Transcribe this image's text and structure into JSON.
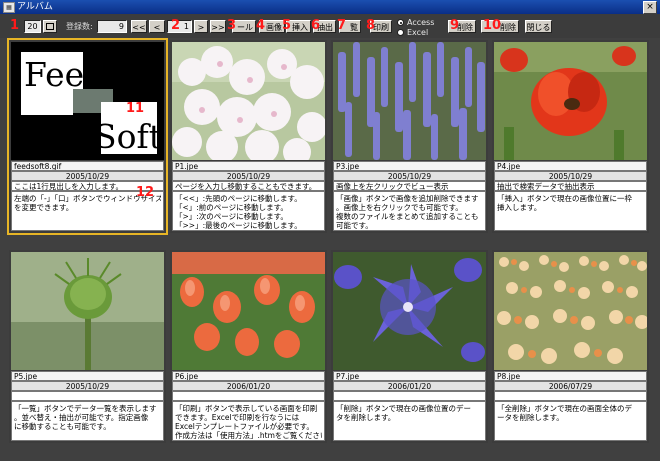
{
  "window": {
    "title": "アルバム",
    "close": "×"
  },
  "toolbar": {
    "count_value": "20",
    "label_registered": "登録数:",
    "registered_value": "9",
    "first": "<<",
    "prev": "<",
    "page_value": "1",
    "next": ">",
    "last": ">>",
    "tool": "ール",
    "image": "画像",
    "insert": "挿入",
    "extract": "抽出",
    "list": "覧",
    "print": "印刷",
    "radio_access": "Access",
    "radio_excel": "Excel",
    "delete": "削除",
    "delete_all": "削除",
    "close": "閉じる"
  },
  "markers": [
    "1",
    "2",
    "3",
    "4",
    "5",
    "6",
    "7",
    "8",
    "9",
    "10",
    "11",
    "12"
  ],
  "cards": [
    {
      "file": "feedsoft8.gif",
      "date": "2005/10/29",
      "caption": "ここは1行見出しを入力します。",
      "desc": [
        "左端の「-」「口」ボタンでウィンドウサイズ",
        "を変更できます。",
        ""
      ],
      "logo_text_top": "Feed",
      "logo_text_bottom": "Soft"
    },
    {
      "file": "P1.jpe",
      "date": "2005/10/29",
      "caption": "ページを入力し移動することもできます。",
      "desc": [
        "「<<」:先頭のページに移動します。",
        "「<」:前のページに移動します。",
        "「>」:次のページに移動します。",
        "「>>」:最後のページに移動します。"
      ]
    },
    {
      "file": "P3.jpe",
      "date": "2005/10/29",
      "caption": "画像上を左クリックでビュー表示",
      "desc": [
        "「画像」ボタンで画像を追加削除できます",
        "。画像上を右クリックでも可能です。",
        "複数のファイルをまとめて追加することも",
        "可能です。"
      ]
    },
    {
      "file": "P4.jpe",
      "date": "2005/10/29",
      "caption": "抽出で検索データで抽出表示",
      "desc": [
        "「挿入」ボタンで現在の画像位置に一枠",
        "挿入します。",
        ""
      ]
    },
    {
      "file": "P5.jpe",
      "date": "2005/10/29",
      "caption": "",
      "desc": [
        "「一覧」ボタンでデータ一覧を表示します",
        "。並べ替え・抽出が可能です。指定画像",
        "に移動することも可能です。"
      ]
    },
    {
      "file": "P6.jpe",
      "date": "2006/01/20",
      "caption": "",
      "desc": [
        "「印刷」ボタンで表示している画面を印刷",
        "できます。Excelで印刷を行なうには",
        "Excelテンプレートファイルが必要です。",
        "作成方法は「使用方法」.htmをご覧ください"
      ]
    },
    {
      "file": "P7.jpe",
      "date": "2006/01/20",
      "caption": "",
      "desc": [
        "「削除」ボタンで現在の画像位置のデー",
        "タを削除します。",
        ""
      ]
    },
    {
      "file": "P8.jpe",
      "date": "2006/07/29",
      "caption": "",
      "desc": [
        "「全削除」ボタンで現在の画面全体のデ",
        "ータを削除します。",
        ""
      ]
    }
  ],
  "colors": {
    "marker": "#ff1a1a",
    "selection": "#e7b526"
  }
}
